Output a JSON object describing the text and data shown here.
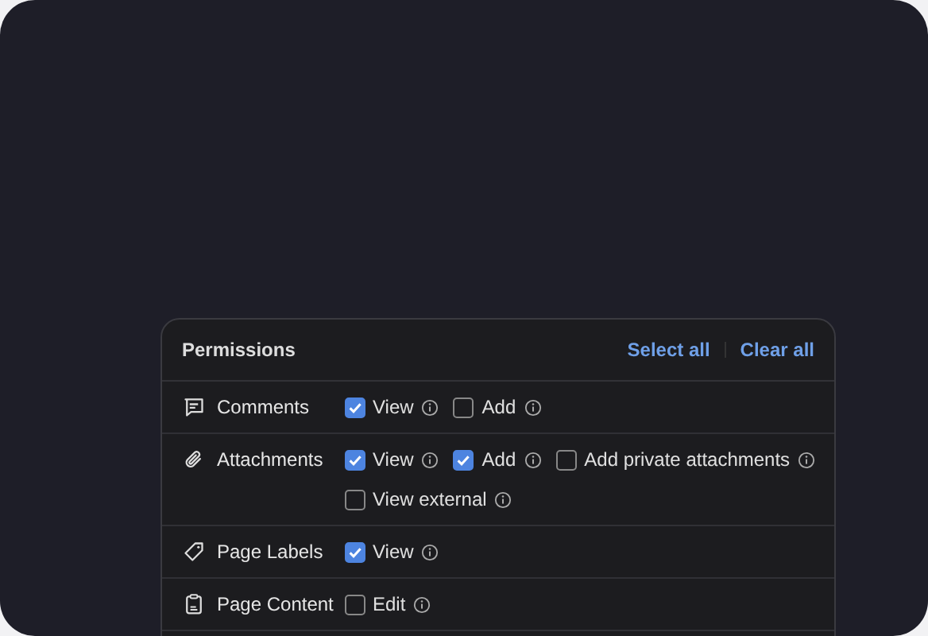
{
  "panel": {
    "title": "Permissions",
    "actions": [
      "Select all",
      "Clear all"
    ]
  },
  "permissions": [
    {
      "name": "Comments",
      "options": [
        {
          "label": "View",
          "checked": true
        },
        {
          "label": "Add",
          "checked": false
        }
      ]
    },
    {
      "name": "Attachments",
      "options": [
        {
          "label": "View",
          "checked": true
        },
        {
          "label": "Add",
          "checked": true
        },
        {
          "label": "Add private attachments",
          "checked": false
        },
        {
          "label": "View external",
          "checked": false
        }
      ]
    },
    {
      "name": "Page Labels",
      "options": [
        {
          "label": "View",
          "checked": true
        }
      ]
    },
    {
      "name": "Page Content",
      "options": [
        {
          "label": "Edit",
          "checked": false
        }
      ]
    }
  ]
}
